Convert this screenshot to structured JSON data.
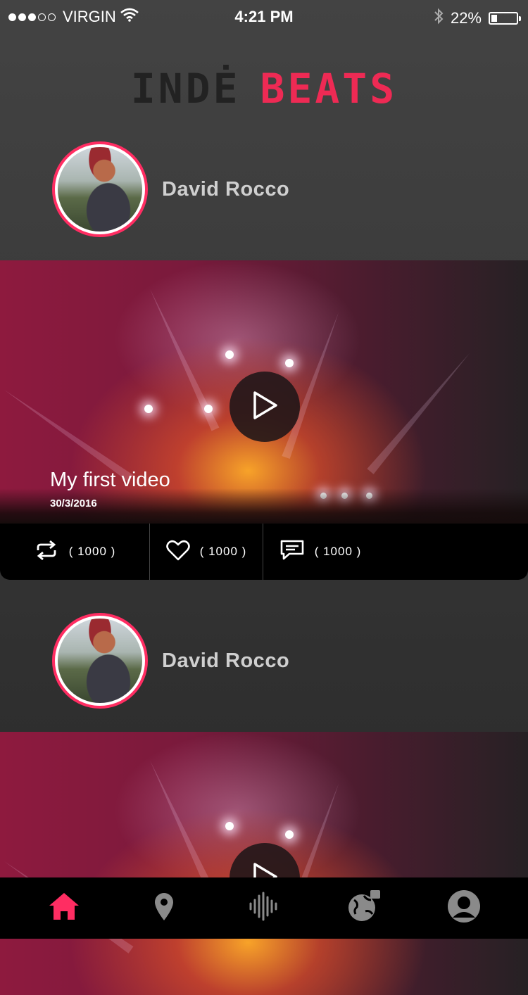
{
  "status_bar": {
    "carrier": "VIRGIN",
    "time": "4:21 PM",
    "battery": "22%",
    "battery_level": 0.22,
    "signal_bars_filled": 3,
    "signal_bars_total": 5
  },
  "app": {
    "logo_part1": "INDĖ",
    "logo_part2": "BEATS",
    "accent_color": "#ff2d62"
  },
  "feed": [
    {
      "author": "David Rocco",
      "video_title": "My first video",
      "video_date": "30/3/2016",
      "reposts": "( 1000 )",
      "likes": "( 1000 )",
      "comments": "( 1000 )"
    },
    {
      "author": "David Rocco"
    }
  ],
  "tabs": [
    {
      "icon": "home-icon",
      "active": true
    },
    {
      "icon": "location-pin-icon",
      "active": false
    },
    {
      "icon": "audio-waveform-icon",
      "active": false
    },
    {
      "icon": "globe-icon",
      "active": false
    },
    {
      "icon": "profile-icon",
      "active": false
    }
  ]
}
